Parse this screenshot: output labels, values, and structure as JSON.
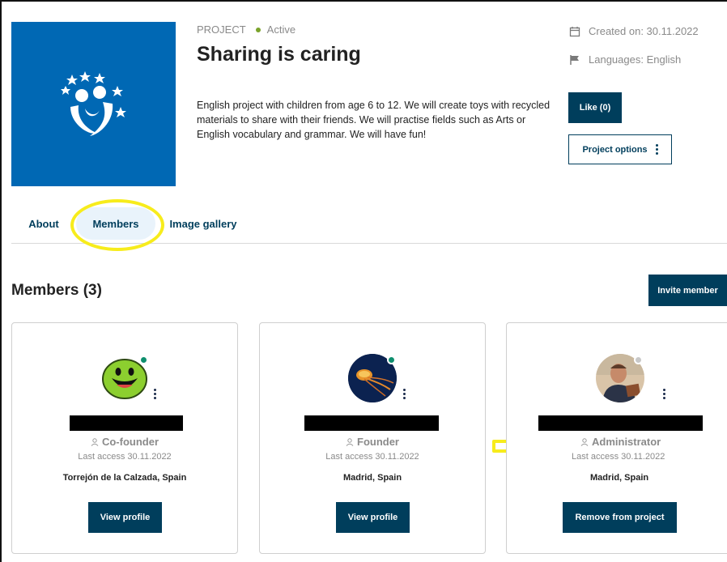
{
  "project": {
    "label": "PROJECT",
    "status": "Active",
    "title": "Sharing is caring",
    "description": "English project with children from age 6 to 12. We will create toys with recycled materials to share with their friends. We will practise fields such as Arts or English vocabulary and grammar. We will have fun!",
    "created": "Created on: 30.11.2022",
    "languages": "Languages: English",
    "like_label": "Like (0)",
    "options_label": "Project options"
  },
  "colors": {
    "brand_blue": "#0068b4",
    "primary_dark": "#003e5c",
    "status_green": "#7aa32b",
    "online_green": "#0e8f6e",
    "offline_gray": "#c8c8c8",
    "highlight_yellow": "#f7ec1c"
  },
  "tabs": [
    {
      "label": "About"
    },
    {
      "label": "Members",
      "active": true
    },
    {
      "label": "Image gallery"
    }
  ],
  "members": {
    "title": "Members (3)",
    "invite_label": "Invite member",
    "list": [
      {
        "role": "Co-founder",
        "last_access": "Last access 30.11.2022",
        "location": "Torrejón de la Calzada, Spain",
        "action": "View profile",
        "online": true
      },
      {
        "role": "Founder",
        "last_access": "Last access 30.11.2022",
        "location": "Madrid, Spain",
        "action": "View profile",
        "online": true
      },
      {
        "role": "Administrator",
        "last_access": "Last access 30.11.2022",
        "location": "Madrid, Spain",
        "action": "Remove from project",
        "online": false
      }
    ]
  },
  "icons": {
    "created": "calendar-icon",
    "languages": "flag-icon",
    "role": "user-icon",
    "menu": "kebab-menu-icon"
  }
}
